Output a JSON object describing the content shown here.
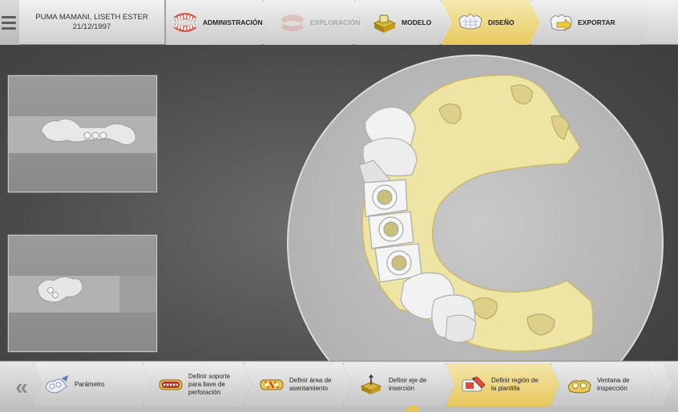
{
  "patient": {
    "name": "PUMA MAMANI, LISETH ESTER",
    "date": "21/12/1997"
  },
  "workflow": {
    "steps": [
      {
        "label": "ADMINISTRACIÓN",
        "icon": "dentures-icon",
        "state": "normal"
      },
      {
        "label": "EXPLORACIÓN",
        "icon": "scan-jaw-icon",
        "state": "disabled"
      },
      {
        "label": "MODELO",
        "icon": "model-base-icon",
        "state": "normal"
      },
      {
        "label": "DISEÑO",
        "icon": "design-crown-icon",
        "state": "active"
      },
      {
        "label": "EXPORTAR",
        "icon": "export-arrow-icon",
        "state": "normal"
      }
    ]
  },
  "tools": {
    "back_label": "«",
    "items": [
      {
        "label": "Parámetro",
        "icon": "parameter-teeth-icon",
        "state": "normal"
      },
      {
        "label": "Definir soporte\npara llave de\nperforación",
        "icon": "drill-key-support-icon",
        "state": "normal"
      },
      {
        "label": "Definir área de\nasentamiento",
        "icon": "seating-area-icon",
        "state": "normal"
      },
      {
        "label": "Definir eje de\ninserción",
        "icon": "insertion-axis-icon",
        "state": "normal"
      },
      {
        "label": "Definir región de\nla plantilla",
        "icon": "template-region-icon",
        "state": "active"
      },
      {
        "label": "Ventana de\ninspección",
        "icon": "inspection-window-icon",
        "state": "normal"
      }
    ]
  },
  "colors": {
    "active_step": "#e8c95d",
    "model_bone": "#efe6a8",
    "crown_white": "#f2f2f2"
  }
}
